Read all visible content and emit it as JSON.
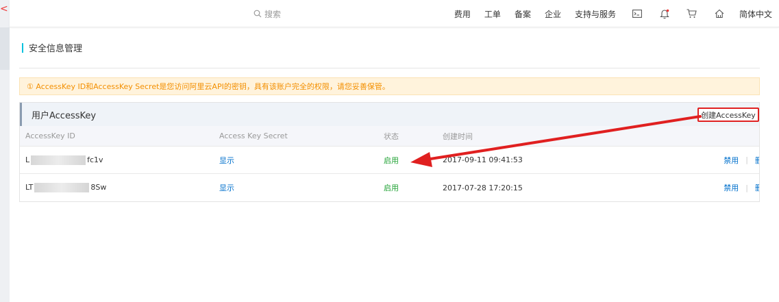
{
  "topbar": {
    "search_placeholder": "搜索",
    "nav": [
      "费用",
      "工单",
      "备案",
      "企业",
      "支持与服务"
    ],
    "language": "简体中文"
  },
  "page": {
    "title": "安全信息管理",
    "warning": "① AccessKey ID和AccessKey Secret是您访问阿里云API的密钥，具有该账户完全的权限，请您妥善保管。"
  },
  "panel": {
    "title": "用户AccessKey",
    "create_label": "创建AccessKey",
    "columns": [
      "AccessKey ID",
      "Access Key Secret",
      "状态",
      "创建时间"
    ],
    "rows": [
      {
        "id_prefix": "L",
        "id_suffix": "fc1v",
        "secret": "显示",
        "status": "启用",
        "created": "2017-09-11 09:41:53",
        "disable": "禁用",
        "delete": "删"
      },
      {
        "id_prefix": "LT",
        "id_suffix": "8Sw",
        "secret": "显示",
        "status": "启用",
        "created": "2017-07-28 17:20:15",
        "disable": "禁用",
        "delete": "删"
      }
    ]
  },
  "colors": {
    "accent": "#00c1de",
    "link": "#0070cc",
    "status": "#1fa233",
    "annotation": "#e02020"
  }
}
